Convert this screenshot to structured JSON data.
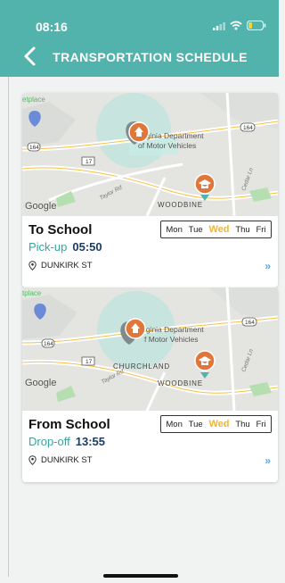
{
  "status": {
    "time": "08:16"
  },
  "header": {
    "title": "TRANSPORTATION SCHEDULE"
  },
  "days": [
    "Mon",
    "Tue",
    "Wed",
    "Thu",
    "Fri"
  ],
  "active_day": "Wed",
  "cards": [
    {
      "title": "To School",
      "kind_label": "Pick-up",
      "time": "05:50",
      "address": "DUNKIRK ST",
      "map": {
        "place_top": "etplace",
        "dmv_line1": "irginia Department",
        "dmv_line2": "of Motor Vehicles",
        "area": "WOODBINE",
        "road_164a": "164",
        "road_164b": "164",
        "road_17": "17",
        "taylor": "Taylor Rd",
        "cedar": "Cedar Ln",
        "brand": "Google",
        "churchland": ""
      }
    },
    {
      "title": "From School",
      "kind_label": "Drop-off",
      "time": "13:55",
      "address": "DUNKIRK ST",
      "map": {
        "place_top": "tplace",
        "dmv_line1": "rginia Department",
        "dmv_line2": "f Motor Vehicles",
        "area": "WOODBINE",
        "road_164a": "164",
        "road_164b": "164",
        "road_17": "17",
        "taylor": "Taylor Rd",
        "cedar": "Cedar Ln",
        "brand": "Google",
        "churchland": "CHURCHLAND"
      }
    }
  ],
  "colors": {
    "header": "#52b3ad",
    "accent_teal": "#3aa39c",
    "active_day": "#f1b43c",
    "time_value": "#1c3d63",
    "chevron": "#5aa6d8",
    "marker": "#e0773a"
  }
}
